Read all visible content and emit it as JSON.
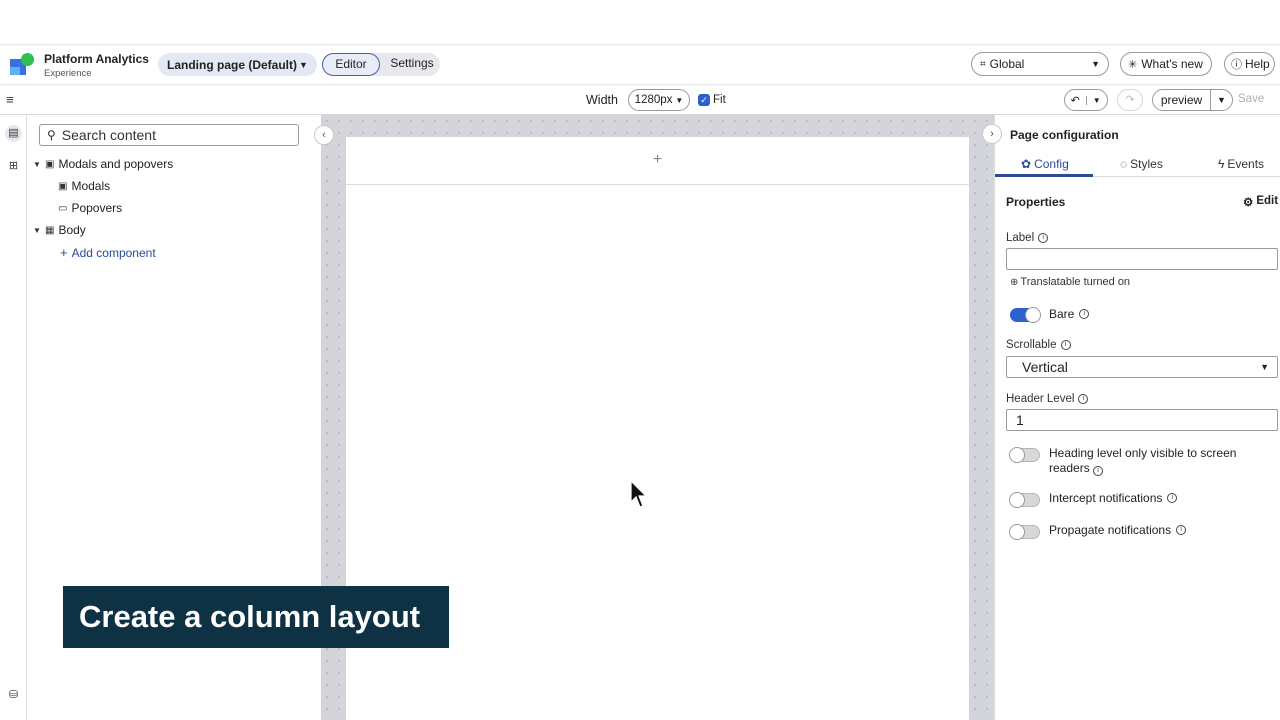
{
  "header": {
    "app_title": "Platform Analytics",
    "app_subtitle": "Experience",
    "page_selector": "Landing page (Default)",
    "mode_tabs": [
      "Editor",
      "Settings"
    ],
    "locale": "Global",
    "whats_new": "What's new",
    "help": "Help"
  },
  "toolbar": {
    "width_label": "Width",
    "width_value": "1280px",
    "fit_label": "Fit",
    "fit_checked": true,
    "preview_label": "preview",
    "save_label": "Save"
  },
  "tree": {
    "search_placeholder": "Search content",
    "items": [
      {
        "label": "Modals and popovers",
        "icon": "modal-icon",
        "expanded": true
      },
      {
        "label": "Modals",
        "icon": "modal-icon"
      },
      {
        "label": "Popovers",
        "icon": "popover-icon"
      },
      {
        "label": "Body",
        "icon": "layout-icon",
        "expanded": true
      },
      {
        "label": "Add component",
        "icon": "plus-icon"
      }
    ]
  },
  "canvas": {
    "add_symbol": "+"
  },
  "banner": {
    "text": "Create a column layout"
  },
  "panel": {
    "title": "Page configuration",
    "tabs": [
      "Config",
      "Styles",
      "Events"
    ],
    "properties_heading": "Properties",
    "edit_label": "Edit",
    "label_field_label": "Label",
    "label_field_value": "",
    "translatable_note": "Translatable turned on",
    "bare_label": "Bare",
    "bare_on": true,
    "scrollable_label": "Scrollable",
    "scrollable_value": "Vertical",
    "header_level_label": "Header Level",
    "header_level_value": "1",
    "heading_visibility_label": "Heading level only visible to screen readers",
    "intercept_label": "Intercept notifications",
    "propagate_label": "Propagate notifications"
  },
  "colors": {
    "accent": "#2f5fd0",
    "banner_bg": "#0e3244",
    "link": "#2b4a9b"
  }
}
